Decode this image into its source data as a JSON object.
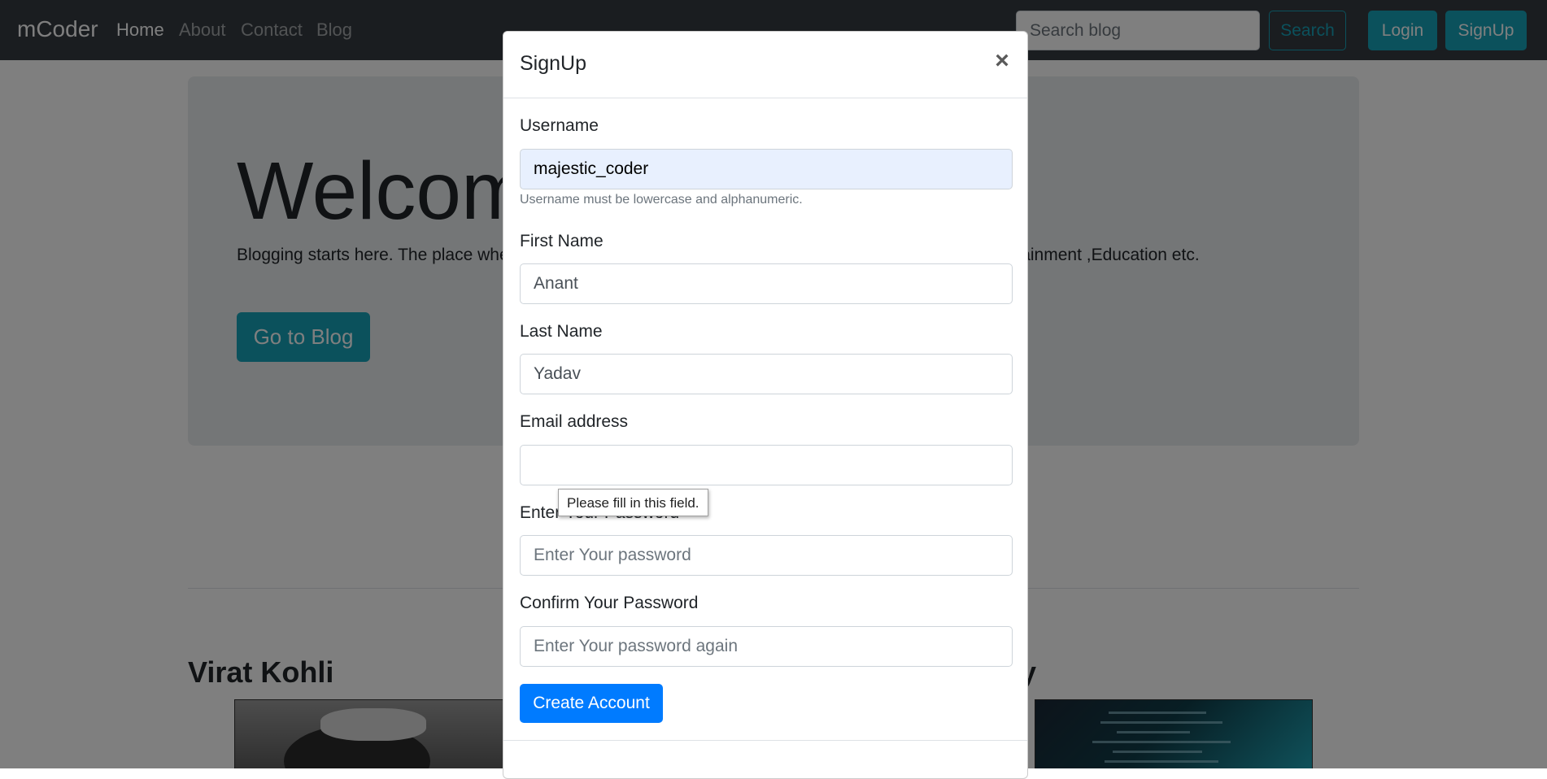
{
  "navbar": {
    "brand": "mCoder",
    "links": [
      "Home",
      "About",
      "Contact",
      "Blog"
    ],
    "search": {
      "placeholder": "Search blog",
      "value": ""
    },
    "search_button": "Search",
    "login_button": "Login",
    "signup_button": "SignUp"
  },
  "jumbotron": {
    "title": "Welcome",
    "text": "Blogging starts here. The place where you can write on any topic whether it is Technology,Sports ,Entertainment ,Education etc.",
    "button": "Go to Blog"
  },
  "cards": [
    {
      "title": "Virat Kohli"
    },
    {
      "title": "jQuery"
    }
  ],
  "modal": {
    "title": "SignUp",
    "close": "×",
    "fields": {
      "username": {
        "label": "Username",
        "value": "majestic_coder",
        "help": "Username must be lowercase and alphanumeric."
      },
      "first_name": {
        "label": "First Name",
        "value": "Anant"
      },
      "last_name": {
        "label": "Last Name",
        "value": "Yadav"
      },
      "email": {
        "label": "Email address",
        "value": "",
        "placeholder": ""
      },
      "password": {
        "label": "Enter Your Password",
        "placeholder": "Enter Your password"
      },
      "confirm_password": {
        "label": "Confirm Your Password",
        "placeholder": "Enter Your password again"
      }
    },
    "submit": "Create Account",
    "validation_tooltip": "Please fill in this field."
  },
  "colors": {
    "navbar_bg": "#343a40",
    "info": "#17a2b8",
    "primary": "#007bff",
    "jumbotron_bg": "#e9ecef",
    "autofill_bg": "#e8f0fe"
  }
}
